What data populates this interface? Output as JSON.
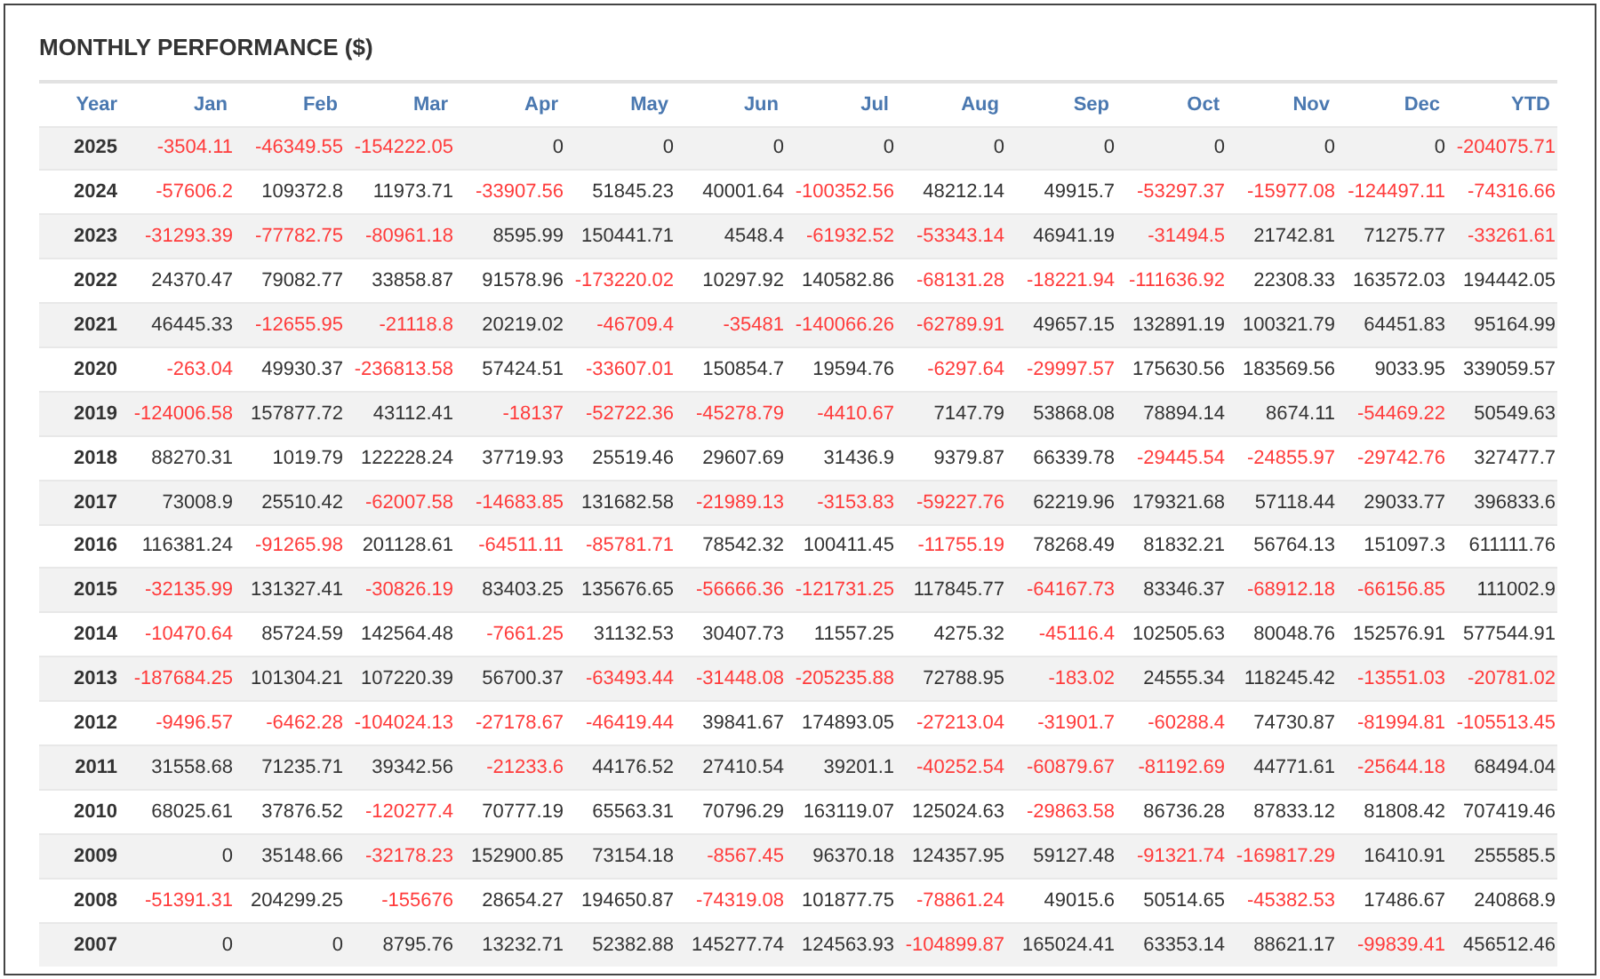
{
  "title": "MONTHLY PERFORMANCE ($)",
  "columns": [
    "Year",
    "Jan",
    "Feb",
    "Mar",
    "Apr",
    "May",
    "Jun",
    "Jul",
    "Aug",
    "Sep",
    "Oct",
    "Nov",
    "Dec",
    "YTD"
  ],
  "rows": [
    {
      "year": "2025",
      "cells": [
        {
          "text": "-3504.11",
          "negative": true
        },
        {
          "text": "-46349.55",
          "negative": true
        },
        {
          "text": "-154222.05",
          "negative": true
        },
        {
          "text": "0",
          "negative": false
        },
        {
          "text": "0",
          "negative": false
        },
        {
          "text": "0",
          "negative": false
        },
        {
          "text": "0",
          "negative": false
        },
        {
          "text": "0",
          "negative": false
        },
        {
          "text": "0",
          "negative": false
        },
        {
          "text": "0",
          "negative": false
        },
        {
          "text": "0",
          "negative": false
        },
        {
          "text": "0",
          "negative": false
        },
        {
          "text": "-204075.71",
          "negative": true
        }
      ]
    },
    {
      "year": "2024",
      "cells": [
        {
          "text": "-57606.2",
          "negative": true
        },
        {
          "text": "109372.8",
          "negative": false
        },
        {
          "text": "11973.71",
          "negative": false
        },
        {
          "text": "-33907.56",
          "negative": true
        },
        {
          "text": "51845.23",
          "negative": false
        },
        {
          "text": "40001.64",
          "negative": false
        },
        {
          "text": "-100352.56",
          "negative": true
        },
        {
          "text": "48212.14",
          "negative": false
        },
        {
          "text": "49915.7",
          "negative": false
        },
        {
          "text": "-53297.37",
          "negative": true
        },
        {
          "text": "-15977.08",
          "negative": true
        },
        {
          "text": "-124497.11",
          "negative": true
        },
        {
          "text": "-74316.66",
          "negative": true
        }
      ]
    },
    {
      "year": "2023",
      "cells": [
        {
          "text": "-31293.39",
          "negative": true
        },
        {
          "text": "-77782.75",
          "negative": true
        },
        {
          "text": "-80961.18",
          "negative": true
        },
        {
          "text": "8595.99",
          "negative": false
        },
        {
          "text": "150441.71",
          "negative": false
        },
        {
          "text": "4548.4",
          "negative": false
        },
        {
          "text": "-61932.52",
          "negative": true
        },
        {
          "text": "-53343.14",
          "negative": true
        },
        {
          "text": "46941.19",
          "negative": false
        },
        {
          "text": "-31494.5",
          "negative": true
        },
        {
          "text": "21742.81",
          "negative": false
        },
        {
          "text": "71275.77",
          "negative": false
        },
        {
          "text": "-33261.61",
          "negative": true
        }
      ]
    },
    {
      "year": "2022",
      "cells": [
        {
          "text": "24370.47",
          "negative": false
        },
        {
          "text": "79082.77",
          "negative": false
        },
        {
          "text": "33858.87",
          "negative": false
        },
        {
          "text": "91578.96",
          "negative": false
        },
        {
          "text": "-173220.02",
          "negative": true
        },
        {
          "text": "10297.92",
          "negative": false
        },
        {
          "text": "140582.86",
          "negative": false
        },
        {
          "text": "-68131.28",
          "negative": true
        },
        {
          "text": "-18221.94",
          "negative": true
        },
        {
          "text": "-111636.92",
          "negative": true
        },
        {
          "text": "22308.33",
          "negative": false
        },
        {
          "text": "163572.03",
          "negative": false
        },
        {
          "text": "194442.05",
          "negative": false
        }
      ]
    },
    {
      "year": "2021",
      "cells": [
        {
          "text": "46445.33",
          "negative": false
        },
        {
          "text": "-12655.95",
          "negative": true
        },
        {
          "text": "-21118.8",
          "negative": true
        },
        {
          "text": "20219.02",
          "negative": false
        },
        {
          "text": "-46709.4",
          "negative": true
        },
        {
          "text": "-35481",
          "negative": true
        },
        {
          "text": "-140066.26",
          "negative": true
        },
        {
          "text": "-62789.91",
          "negative": true
        },
        {
          "text": "49657.15",
          "negative": false
        },
        {
          "text": "132891.19",
          "negative": false
        },
        {
          "text": "100321.79",
          "negative": false
        },
        {
          "text": "64451.83",
          "negative": false
        },
        {
          "text": "95164.99",
          "negative": false
        }
      ]
    },
    {
      "year": "2020",
      "cells": [
        {
          "text": "-263.04",
          "negative": true
        },
        {
          "text": "49930.37",
          "negative": false
        },
        {
          "text": "-236813.58",
          "negative": true
        },
        {
          "text": "57424.51",
          "negative": false
        },
        {
          "text": "-33607.01",
          "negative": true
        },
        {
          "text": "150854.7",
          "negative": false
        },
        {
          "text": "19594.76",
          "negative": false
        },
        {
          "text": "-6297.64",
          "negative": true
        },
        {
          "text": "-29997.57",
          "negative": true
        },
        {
          "text": "175630.56",
          "negative": false
        },
        {
          "text": "183569.56",
          "negative": false
        },
        {
          "text": "9033.95",
          "negative": false
        },
        {
          "text": "339059.57",
          "negative": false
        }
      ]
    },
    {
      "year": "2019",
      "cells": [
        {
          "text": "-124006.58",
          "negative": true
        },
        {
          "text": "157877.72",
          "negative": false
        },
        {
          "text": "43112.41",
          "negative": false
        },
        {
          "text": "-18137",
          "negative": true
        },
        {
          "text": "-52722.36",
          "negative": true
        },
        {
          "text": "-45278.79",
          "negative": true
        },
        {
          "text": "-4410.67",
          "negative": true
        },
        {
          "text": "7147.79",
          "negative": false
        },
        {
          "text": "53868.08",
          "negative": false
        },
        {
          "text": "78894.14",
          "negative": false
        },
        {
          "text": "8674.11",
          "negative": false
        },
        {
          "text": "-54469.22",
          "negative": true
        },
        {
          "text": "50549.63",
          "negative": false
        }
      ]
    },
    {
      "year": "2018",
      "cells": [
        {
          "text": "88270.31",
          "negative": false
        },
        {
          "text": "1019.79",
          "negative": false
        },
        {
          "text": "122228.24",
          "negative": false
        },
        {
          "text": "37719.93",
          "negative": false
        },
        {
          "text": "25519.46",
          "negative": false
        },
        {
          "text": "29607.69",
          "negative": false
        },
        {
          "text": "31436.9",
          "negative": false
        },
        {
          "text": "9379.87",
          "negative": false
        },
        {
          "text": "66339.78",
          "negative": false
        },
        {
          "text": "-29445.54",
          "negative": true
        },
        {
          "text": "-24855.97",
          "negative": true
        },
        {
          "text": "-29742.76",
          "negative": true
        },
        {
          "text": "327477.7",
          "negative": false
        }
      ]
    },
    {
      "year": "2017",
      "cells": [
        {
          "text": "73008.9",
          "negative": false
        },
        {
          "text": "25510.42",
          "negative": false
        },
        {
          "text": "-62007.58",
          "negative": true
        },
        {
          "text": "-14683.85",
          "negative": true
        },
        {
          "text": "131682.58",
          "negative": false
        },
        {
          "text": "-21989.13",
          "negative": true
        },
        {
          "text": "-3153.83",
          "negative": true
        },
        {
          "text": "-59227.76",
          "negative": true
        },
        {
          "text": "62219.96",
          "negative": false
        },
        {
          "text": "179321.68",
          "negative": false
        },
        {
          "text": "57118.44",
          "negative": false
        },
        {
          "text": "29033.77",
          "negative": false
        },
        {
          "text": "396833.6",
          "negative": false
        }
      ]
    },
    {
      "year": "2016",
      "cells": [
        {
          "text": "116381.24",
          "negative": false
        },
        {
          "text": "-91265.98",
          "negative": true
        },
        {
          "text": "201128.61",
          "negative": false
        },
        {
          "text": "-64511.11",
          "negative": true
        },
        {
          "text": "-85781.71",
          "negative": true
        },
        {
          "text": "78542.32",
          "negative": false
        },
        {
          "text": "100411.45",
          "negative": false
        },
        {
          "text": "-11755.19",
          "negative": true
        },
        {
          "text": "78268.49",
          "negative": false
        },
        {
          "text": "81832.21",
          "negative": false
        },
        {
          "text": "56764.13",
          "negative": false
        },
        {
          "text": "151097.3",
          "negative": false
        },
        {
          "text": "611111.76",
          "negative": false
        }
      ]
    },
    {
      "year": "2015",
      "cells": [
        {
          "text": "-32135.99",
          "negative": true
        },
        {
          "text": "131327.41",
          "negative": false
        },
        {
          "text": "-30826.19",
          "negative": true
        },
        {
          "text": "83403.25",
          "negative": false
        },
        {
          "text": "135676.65",
          "negative": false
        },
        {
          "text": "-56666.36",
          "negative": true
        },
        {
          "text": "-121731.25",
          "negative": true
        },
        {
          "text": "117845.77",
          "negative": false
        },
        {
          "text": "-64167.73",
          "negative": true
        },
        {
          "text": "83346.37",
          "negative": false
        },
        {
          "text": "-68912.18",
          "negative": true
        },
        {
          "text": "-66156.85",
          "negative": true
        },
        {
          "text": "111002.9",
          "negative": false
        }
      ]
    },
    {
      "year": "2014",
      "cells": [
        {
          "text": "-10470.64",
          "negative": true
        },
        {
          "text": "85724.59",
          "negative": false
        },
        {
          "text": "142564.48",
          "negative": false
        },
        {
          "text": "-7661.25",
          "negative": true
        },
        {
          "text": "31132.53",
          "negative": false
        },
        {
          "text": "30407.73",
          "negative": false
        },
        {
          "text": "11557.25",
          "negative": false
        },
        {
          "text": "4275.32",
          "negative": false
        },
        {
          "text": "-45116.4",
          "negative": true
        },
        {
          "text": "102505.63",
          "negative": false
        },
        {
          "text": "80048.76",
          "negative": false
        },
        {
          "text": "152576.91",
          "negative": false
        },
        {
          "text": "577544.91",
          "negative": false
        }
      ]
    },
    {
      "year": "2013",
      "cells": [
        {
          "text": "-187684.25",
          "negative": true
        },
        {
          "text": "101304.21",
          "negative": false
        },
        {
          "text": "107220.39",
          "negative": false
        },
        {
          "text": "56700.37",
          "negative": false
        },
        {
          "text": "-63493.44",
          "negative": true
        },
        {
          "text": "-31448.08",
          "negative": true
        },
        {
          "text": "-205235.88",
          "negative": true
        },
        {
          "text": "72788.95",
          "negative": false
        },
        {
          "text": "-183.02",
          "negative": true
        },
        {
          "text": "24555.34",
          "negative": false
        },
        {
          "text": "118245.42",
          "negative": false
        },
        {
          "text": "-13551.03",
          "negative": true
        },
        {
          "text": "-20781.02",
          "negative": true
        }
      ]
    },
    {
      "year": "2012",
      "cells": [
        {
          "text": "-9496.57",
          "negative": true
        },
        {
          "text": "-6462.28",
          "negative": true
        },
        {
          "text": "-104024.13",
          "negative": true
        },
        {
          "text": "-27178.67",
          "negative": true
        },
        {
          "text": "-46419.44",
          "negative": true
        },
        {
          "text": "39841.67",
          "negative": false
        },
        {
          "text": "174893.05",
          "negative": false
        },
        {
          "text": "-27213.04",
          "negative": true
        },
        {
          "text": "-31901.7",
          "negative": true
        },
        {
          "text": "-60288.4",
          "negative": true
        },
        {
          "text": "74730.87",
          "negative": false
        },
        {
          "text": "-81994.81",
          "negative": true
        },
        {
          "text": "-105513.45",
          "negative": true
        }
      ]
    },
    {
      "year": "2011",
      "cells": [
        {
          "text": "31558.68",
          "negative": false
        },
        {
          "text": "71235.71",
          "negative": false
        },
        {
          "text": "39342.56",
          "negative": false
        },
        {
          "text": "-21233.6",
          "negative": true
        },
        {
          "text": "44176.52",
          "negative": false
        },
        {
          "text": "27410.54",
          "negative": false
        },
        {
          "text": "39201.1",
          "negative": false
        },
        {
          "text": "-40252.54",
          "negative": true
        },
        {
          "text": "-60879.67",
          "negative": true
        },
        {
          "text": "-81192.69",
          "negative": true
        },
        {
          "text": "44771.61",
          "negative": false
        },
        {
          "text": "-25644.18",
          "negative": true
        },
        {
          "text": "68494.04",
          "negative": false
        }
      ]
    },
    {
      "year": "2010",
      "cells": [
        {
          "text": "68025.61",
          "negative": false
        },
        {
          "text": "37876.52",
          "negative": false
        },
        {
          "text": "-120277.4",
          "negative": true
        },
        {
          "text": "70777.19",
          "negative": false
        },
        {
          "text": "65563.31",
          "negative": false
        },
        {
          "text": "70796.29",
          "negative": false
        },
        {
          "text": "163119.07",
          "negative": false
        },
        {
          "text": "125024.63",
          "negative": false
        },
        {
          "text": "-29863.58",
          "negative": true
        },
        {
          "text": "86736.28",
          "negative": false
        },
        {
          "text": "87833.12",
          "negative": false
        },
        {
          "text": "81808.42",
          "negative": false
        },
        {
          "text": "707419.46",
          "negative": false
        }
      ]
    },
    {
      "year": "2009",
      "cells": [
        {
          "text": "0",
          "negative": false
        },
        {
          "text": "35148.66",
          "negative": false
        },
        {
          "text": "-32178.23",
          "negative": true
        },
        {
          "text": "152900.85",
          "negative": false
        },
        {
          "text": "73154.18",
          "negative": false
        },
        {
          "text": "-8567.45",
          "negative": true
        },
        {
          "text": "96370.18",
          "negative": false
        },
        {
          "text": "124357.95",
          "negative": false
        },
        {
          "text": "59127.48",
          "negative": false
        },
        {
          "text": "-91321.74",
          "negative": true
        },
        {
          "text": "-169817.29",
          "negative": true
        },
        {
          "text": "16410.91",
          "negative": false
        },
        {
          "text": "255585.5",
          "negative": false
        }
      ]
    },
    {
      "year": "2008",
      "cells": [
        {
          "text": "-51391.31",
          "negative": true
        },
        {
          "text": "204299.25",
          "negative": false
        },
        {
          "text": "-155676",
          "negative": true
        },
        {
          "text": "28654.27",
          "negative": false
        },
        {
          "text": "194650.87",
          "negative": false
        },
        {
          "text": "-74319.08",
          "negative": true
        },
        {
          "text": "101877.75",
          "negative": false
        },
        {
          "text": "-78861.24",
          "negative": true
        },
        {
          "text": "49015.6",
          "negative": false
        },
        {
          "text": "50514.65",
          "negative": false
        },
        {
          "text": "-45382.53",
          "negative": true
        },
        {
          "text": "17486.67",
          "negative": false
        },
        {
          "text": "240868.9",
          "negative": false
        }
      ]
    },
    {
      "year": "2007",
      "cells": [
        {
          "text": "0",
          "negative": false
        },
        {
          "text": "0",
          "negative": false
        },
        {
          "text": "8795.76",
          "negative": false
        },
        {
          "text": "13232.71",
          "negative": false
        },
        {
          "text": "52382.88",
          "negative": false
        },
        {
          "text": "145277.74",
          "negative": false
        },
        {
          "text": "124563.93",
          "negative": false
        },
        {
          "text": "-104899.87",
          "negative": true
        },
        {
          "text": "165024.41",
          "negative": false
        },
        {
          "text": "63353.14",
          "negative": false
        },
        {
          "text": "88621.17",
          "negative": false
        },
        {
          "text": "-99839.41",
          "negative": true
        },
        {
          "text": "456512.46",
          "negative": false
        }
      ]
    }
  ]
}
